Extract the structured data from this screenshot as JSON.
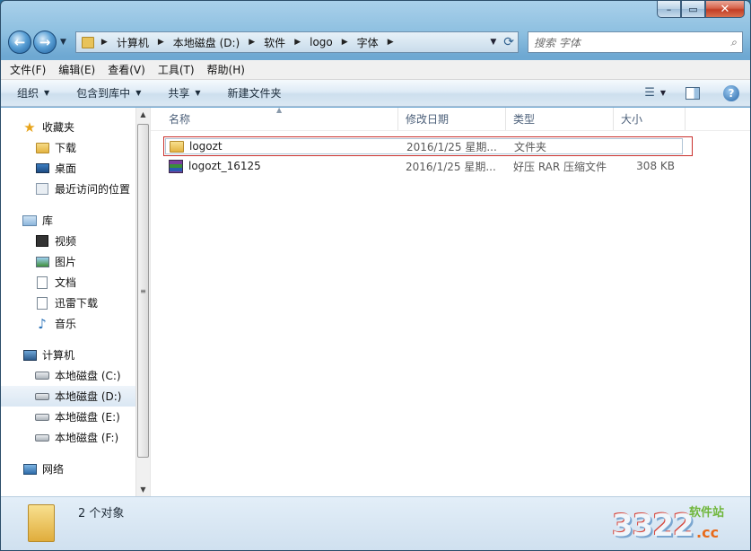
{
  "window": {
    "caption_buttons": {
      "minimize": "▭",
      "maximize": "▫",
      "close": "x"
    }
  },
  "nav": {
    "back_icon": "arrow-left",
    "forward_icon": "arrow-right",
    "breadcrumbs": [
      "计算机",
      "本地磁盘 (D:)",
      "软件",
      "logo",
      "字体"
    ],
    "search_placeholder": "搜索 字体"
  },
  "menubar": {
    "items": [
      "文件(F)",
      "编辑(E)",
      "查看(V)",
      "工具(T)",
      "帮助(H)"
    ]
  },
  "cmdbar": {
    "organize": "组织",
    "include_library": "包含到库中",
    "share": "共享",
    "new_folder": "新建文件夹"
  },
  "navpane": {
    "favorites_label": "收藏夹",
    "favorites": [
      "下载",
      "桌面",
      "最近访问的位置"
    ],
    "libraries_label": "库",
    "libraries": [
      "视频",
      "图片",
      "文档",
      "迅雷下载",
      "音乐"
    ],
    "computer_label": "计算机",
    "drives": [
      "本地磁盘 (C:)",
      "本地磁盘 (D:)",
      "本地磁盘 (E:)",
      "本地磁盘 (F:)"
    ],
    "selected_drive": "本地磁盘 (D:)",
    "network_label": "网络"
  },
  "filelist": {
    "columns": {
      "name": "名称",
      "date": "修改日期",
      "type": "类型",
      "size": "大小"
    },
    "rows": [
      {
        "name": "logozt",
        "date": "2016/1/25 星期...",
        "type": "文件夹",
        "size": "",
        "icon": "folder-icon"
      },
      {
        "name": "logozt_16125",
        "date": "2016/1/25 星期...",
        "type": "好压 RAR 压缩文件",
        "size": "308 KB",
        "icon": "rar-archive-icon"
      }
    ]
  },
  "status": {
    "count_text": "2 个对象"
  },
  "watermark": {
    "number": "3322",
    "suffix": ".cc",
    "label": "软件站"
  }
}
